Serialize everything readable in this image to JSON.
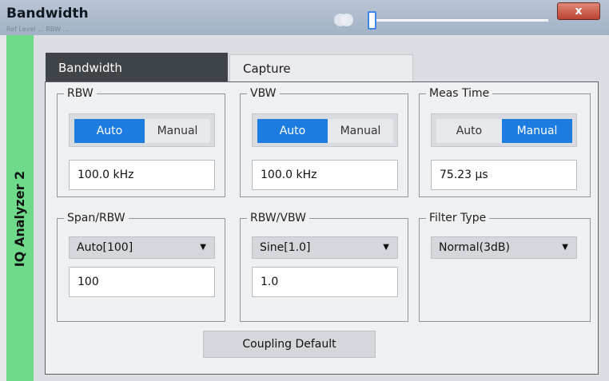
{
  "window": {
    "title": "Bandwidth",
    "subtitle": "Ref Level ... RBW ... ",
    "close_label": "x"
  },
  "sidebar": {
    "label": "IQ Analyzer 2",
    "color": "#6fdb8a"
  },
  "tabs": [
    {
      "label": "Bandwidth",
      "active": true
    },
    {
      "label": "Capture",
      "active": false
    }
  ],
  "rbw": {
    "label": "RBW",
    "options": [
      "Auto",
      "Manual"
    ],
    "selected": "Auto",
    "value": "100.0 kHz"
  },
  "vbw": {
    "label": "VBW",
    "options": [
      "Auto",
      "Manual"
    ],
    "selected": "Auto",
    "value": "100.0 kHz"
  },
  "meas_time": {
    "label": "Meas Time",
    "options": [
      "Auto",
      "Manual"
    ],
    "selected": "Manual",
    "value": "75.23 µs"
  },
  "span_rbw": {
    "label": "Span/RBW",
    "dropdown": "Auto[100]",
    "value": "100"
  },
  "rbw_vbw": {
    "label": "RBW/VBW",
    "dropdown": "Sine[1.0]",
    "value": "1.0"
  },
  "filter_type": {
    "label": "Filter Type",
    "dropdown": "Normal(3dB)"
  },
  "coupling_default_label": "Coupling Default",
  "colors": {
    "accent": "#1c7ce0",
    "active_tab": "#3f4449",
    "close": "#c04a36"
  }
}
